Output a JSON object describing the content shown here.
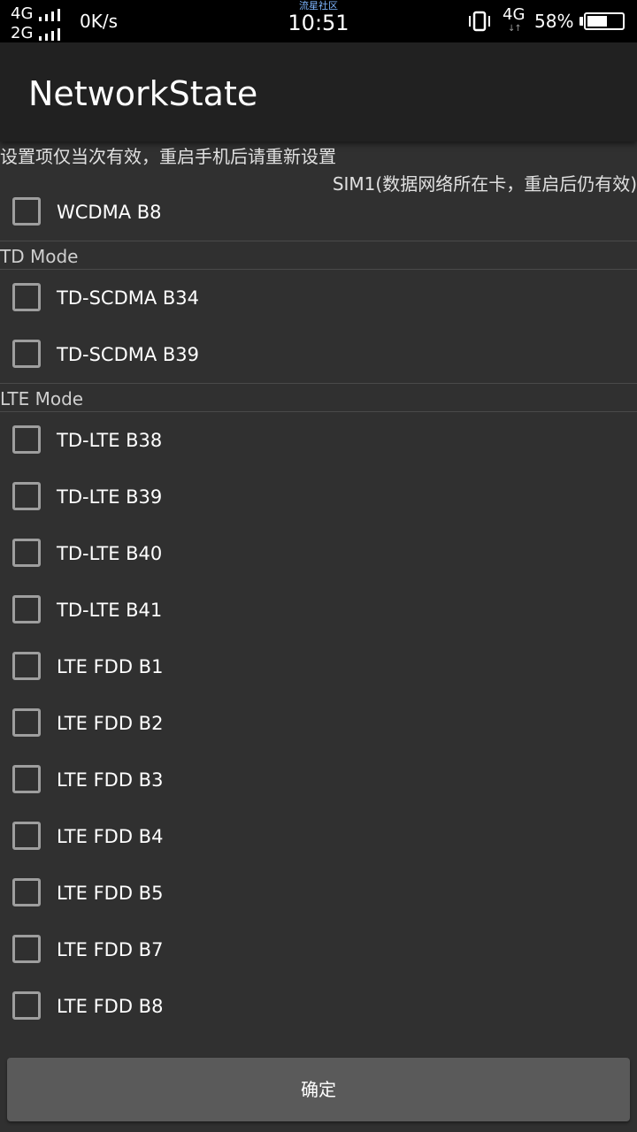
{
  "status_bar": {
    "network_1": "4G",
    "network_2": "2G",
    "speed": "0K/s",
    "carrier": "流星社区",
    "time": "10:51",
    "data_type": "4G",
    "data_arrows": "↓↑",
    "battery_percent": "58%",
    "battery_level": 0.58
  },
  "app": {
    "title": "NetworkState"
  },
  "notice": "设置项仅当次有效，重启手机后请重新设置",
  "sim_label": "SIM1(数据网络所在卡，重启后仍有效)",
  "wcdma_items": [
    {
      "label": "WCDMA B8",
      "checked": false
    }
  ],
  "td_section": {
    "header": "TD Mode",
    "items": [
      {
        "label": "TD-SCDMA B34",
        "checked": false
      },
      {
        "label": "TD-SCDMA B39",
        "checked": false
      }
    ]
  },
  "lte_section": {
    "header": "LTE Mode",
    "items": [
      {
        "label": "TD-LTE B38",
        "checked": false
      },
      {
        "label": "TD-LTE B39",
        "checked": false
      },
      {
        "label": "TD-LTE B40",
        "checked": false
      },
      {
        "label": "TD-LTE B41",
        "checked": false
      },
      {
        "label": "LTE FDD B1",
        "checked": false
      },
      {
        "label": "LTE FDD B2",
        "checked": false
      },
      {
        "label": "LTE FDD B3",
        "checked": false
      },
      {
        "label": "LTE FDD B4",
        "checked": false
      },
      {
        "label": "LTE FDD B5",
        "checked": false
      },
      {
        "label": "LTE FDD B7",
        "checked": false
      },
      {
        "label": "LTE FDD B8",
        "checked": false
      }
    ]
  },
  "confirm_label": "确定"
}
